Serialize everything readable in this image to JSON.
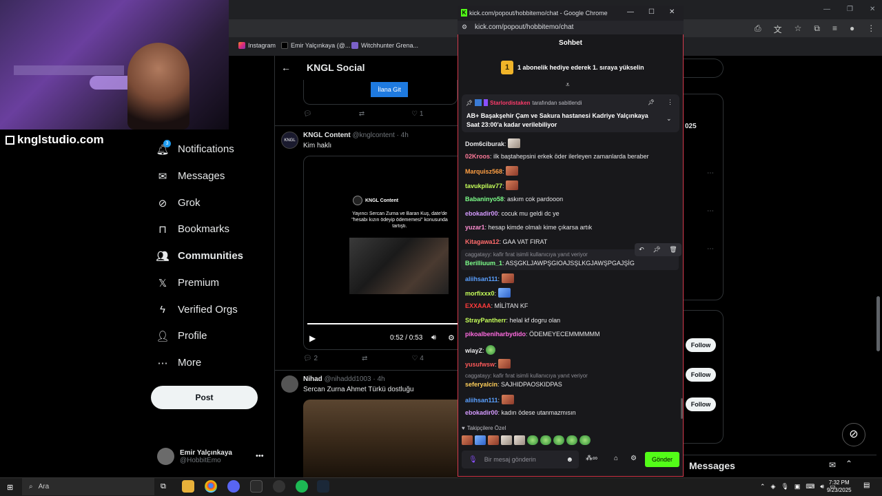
{
  "overlay": {
    "brand": "knglstudio.com"
  },
  "browser": {
    "bookmarks": [
      "Instagram",
      "Emir Yalçınkaya (@...",
      "Witchhunter Grena..."
    ]
  },
  "xnav": {
    "header": "KNGL Social",
    "notif_count": "3",
    "items": [
      "Notifications",
      "Messages",
      "Grok",
      "Bookmarks",
      "Communities",
      "Premium",
      "Verified Orgs",
      "Profile",
      "More"
    ],
    "post": "Post",
    "account_name": "Emir Yalçınkaya",
    "account_handle": "@HobbitEmo"
  },
  "feed": {
    "cta": "İlana Git",
    "reply1": "",
    "like1": "1",
    "tweet1": {
      "author": "KNGL Content",
      "handle": "@knglcontent · 4h",
      "text": "Kim haklı",
      "card_author": "KNGL Content",
      "card_text": "Yayıncı Sercan Zurna ve Baran Kuş, date'de \"hesabı kızın ödeyip ödememesi\" konusunda tartıştı.",
      "time": "0:52 / 0:53",
      "replies": "2",
      "likes": "4"
    },
    "tweet2": {
      "author": "Nihad",
      "handle": "@nihaddd1003 · 4h",
      "text": "Sercan Zurna Ahmet Türkü dostluğu"
    }
  },
  "chat": {
    "window_title": "kick.com/popout/hobbitemo/chat - Google Chrome",
    "url": "kick.com/popout/hobbitemo/chat",
    "header": "Sohbet",
    "gift_banner": "1 abonelik hediye ederek 1. sıraya yükselin",
    "gift_rank": "1",
    "pinned_by_user": "Starlordistaken",
    "pinned_by_suffix": "tarafından sabitlendi",
    "pinned_text": "AB+ Başakşehir Çam ve Sakura hastanesi Kadriye Yalçınkaya Saat 23:00'a kadar verilebiliyor",
    "messages": [
      {
        "user": "Dom6ciburak",
        "color": "#e8e8ea",
        "text": "",
        "emote": "cat"
      },
      {
        "user": "02Kroos",
        "color": "#ff7a9a",
        "text": "ilk baştahepsini erkek öder ilerleyen zamanlarda beraber",
        "emote": ""
      },
      {
        "user": "Marquisz568",
        "color": "#ff9f43",
        "text": "",
        "emote": "face"
      },
      {
        "user": "tavukpilav77",
        "color": "#c6ff5a",
        "text": "",
        "emote": "face"
      },
      {
        "user": "Babaninyo58",
        "color": "#7dff8a",
        "text": "askım cok pardooon",
        "emote": ""
      },
      {
        "user": "ebokadir00",
        "color": "#d59bff",
        "text": "cocuk mu geldi dc ye",
        "emote": ""
      },
      {
        "user": "yuzar1",
        "color": "#ff8fd2",
        "text": "hesap kimde olmalı kime çıkarsa artık",
        "emote": ""
      },
      {
        "user": "Kitagawa12",
        "color": "#ff6b6b",
        "text": "GAA VAT FIRAT",
        "emote": ""
      },
      {
        "user": "Berilliuum_1",
        "color": "#7dff8a",
        "text": "ASŞGKLJAWPŞGIOAJSŞLKGJAWŞPGAJŞİG",
        "emote": "",
        "reply": "caggatayy: kafir fırat isimli kullanıcıya yanıt veriyor"
      },
      {
        "user": "aliihsan111",
        "color": "#5aa0ff",
        "text": "",
        "emote": "face"
      },
      {
        "user": "morfixxx0",
        "color": "#c6ff5a",
        "text": "",
        "emote": "blue"
      },
      {
        "user": "EXXAAA",
        "color": "#ff3b3b",
        "text": "MİLİTAN KF",
        "emote": ""
      },
      {
        "user": "StrayPantherr",
        "color": "#c6ff5a",
        "text": "helal kf dogru olan",
        "emote": ""
      },
      {
        "user": "pikoalbeniharbydido",
        "color": "#ff6be0",
        "text": "ÖDEMEYECEMMMMMM",
        "emote": ""
      },
      {
        "user": "wiayZ",
        "color": "#e8e8ea",
        "text": "",
        "emote": "green"
      },
      {
        "user": "yusufwsw",
        "color": "#ff5a5a",
        "text": "",
        "emote": "face"
      },
      {
        "user": "seferyalcin",
        "color": "#ffcf5a",
        "text": "SAJHIDPAOSKIDPAS",
        "emote": "",
        "reply": "caggatayy: kafir fırat isimli kullanıcıya yanıt veriyor"
      },
      {
        "user": "aliihsan111",
        "color": "#5aa0ff",
        "text": "",
        "emote": "face"
      },
      {
        "user": "ebokadir00",
        "color": "#d59bff",
        "text": "kadın ödese utanmazmısın",
        "emote": ""
      }
    ],
    "followers_label": "Takipçilere Özel",
    "input_placeholder": "Bir mesaj gönderin",
    "send": "Gönder"
  },
  "right": {
    "year_frag": "025",
    "follow": "Follow",
    "messages": "Messages"
  },
  "taskbar": {
    "search": "Ara",
    "time": "7:32 PM",
    "date": "9/23/2025"
  },
  "colors": {
    "kick_green": "#53fc18",
    "x_blue": "#1d9bf0",
    "chat_border": "#d63b4e"
  }
}
